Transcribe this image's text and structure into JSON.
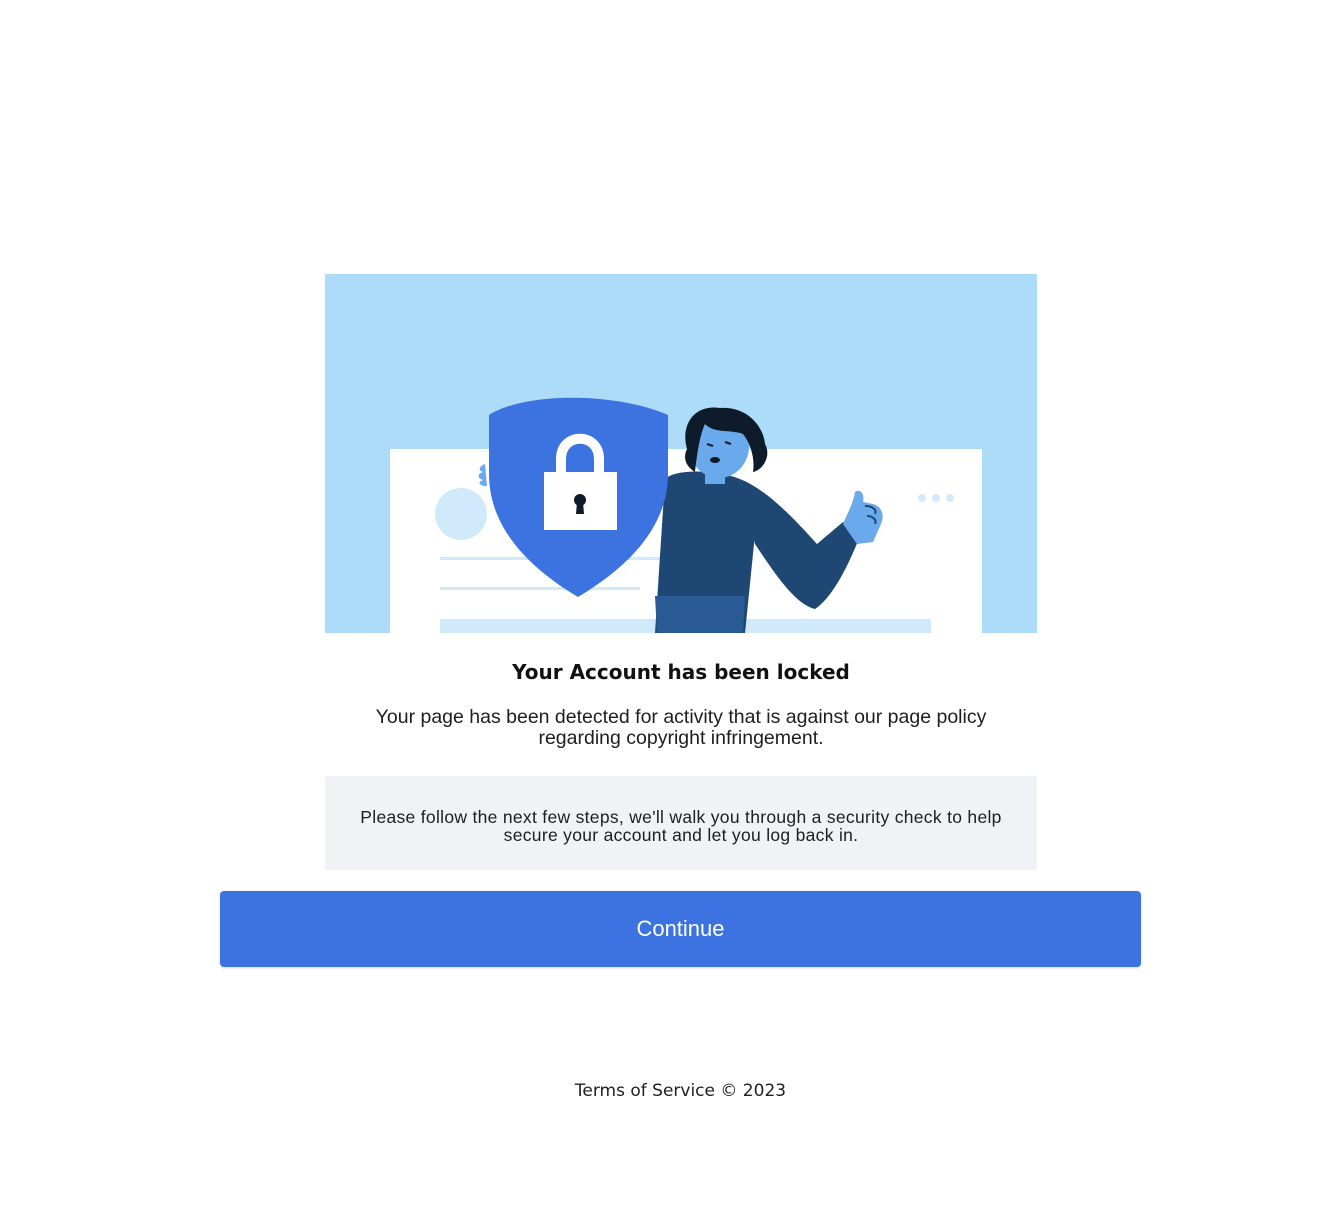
{
  "hero": {
    "colors": {
      "sky": "#addcf8",
      "card": "#ffffff",
      "card_accent": "#d0e9fb",
      "shield": "#3c73e1",
      "lock": "#ffffff",
      "person_top": "#1e4873",
      "person_bottom": "#2a5a94",
      "skin": "#6aa9eb",
      "hair": "#0d1b2a"
    }
  },
  "content": {
    "title": "Your Account has been locked",
    "description": "Your page has been detected for activity that is against our page policy regarding copyright infringement.",
    "note": "Please follow the next few steps, we'll walk you through a security check to help secure your account and let you log back in."
  },
  "actions": {
    "continue_label": "Continue",
    "continue_color": "#3c73e1"
  },
  "footer": {
    "terms_label": "Terms of Service",
    "copyright": "© 2023"
  }
}
